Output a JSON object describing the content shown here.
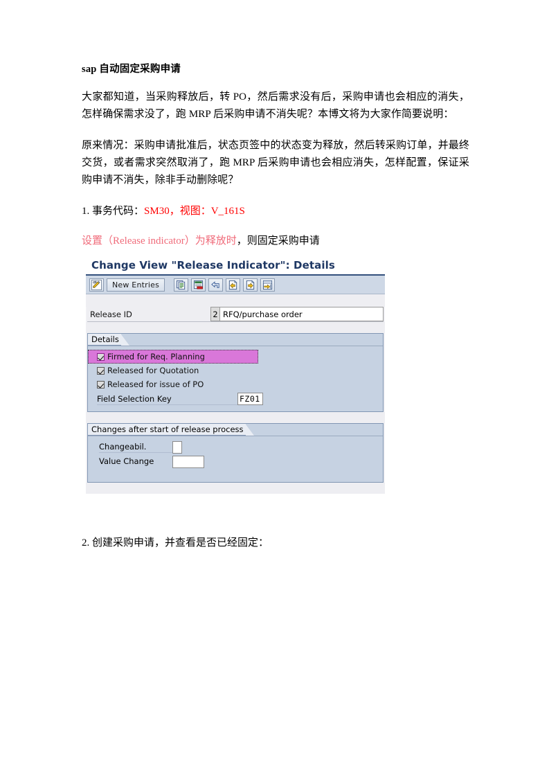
{
  "document": {
    "title": "sap  自动固定采购申请",
    "paragraph_1": "大家都知道，当采购释放后，转 PO，然后需求没有后，采购申请也会相应的消失，怎样确保需求没了，跑 MRP 后采购申请不消失呢？本博文将为大家作简要说明：",
    "paragraph_2": "原来情况：采购申请批准后，状态页签中的状态变为释放，然后转采购订单，并最终交货，或者需求突然取消了，跑 MRP 后采购申请也会相应消失，怎样配置，保证采购申请不消失，除非手动删除呢？",
    "step1_prefix": "1. 事务代码：",
    "step1_red": "SM30，视图：V_161S",
    "step1_note_red": "设置（Release indicator）为释放时",
    "step1_note_black": "，则固定采购申请",
    "step2": "2. 创建采购申请，并查看是否已经固定："
  },
  "colors": {
    "title_blue": "#1f3864",
    "red": "#ff0000",
    "red_light": "#f06b7a",
    "toolbar_bg": "#ced8e6",
    "groupbox_bg": "#c6d2e2",
    "highlight_magenta": "#d977d9",
    "body_bg": "#eeeef2"
  },
  "sap_screen": {
    "title": "Change View \"Release Indicator\": Details",
    "toolbar": {
      "display_change_icon": "pencil-display-change-icon",
      "new_entries_label": "New Entries",
      "copy_icon": "copy-as-icon",
      "delete_icon": "delete-row-icon",
      "undo_icon": "undo-icon",
      "previous_icon": "previous-entry-icon",
      "next_icon": "next-entry-icon",
      "details_icon": "details-icon"
    },
    "release_id": {
      "label": "Release ID",
      "key": "2",
      "text": "RFQ/purchase order"
    },
    "details_group": {
      "legend": "Details",
      "checkboxes": [
        {
          "label": "Firmed for Req. Planning",
          "checked": true,
          "highlighted": true
        },
        {
          "label": "Released for Quotation",
          "checked": true,
          "highlighted": false
        },
        {
          "label": "Released for issue of PO",
          "checked": true,
          "highlighted": false
        }
      ],
      "field_selection_key": {
        "label": "Field Selection Key",
        "value": "FZ01"
      }
    },
    "changes_group": {
      "legend": "Changes after start of release process",
      "fields": [
        {
          "label": "Changeabil.",
          "value": ""
        },
        {
          "label": "Value Change",
          "value": ""
        }
      ]
    }
  }
}
